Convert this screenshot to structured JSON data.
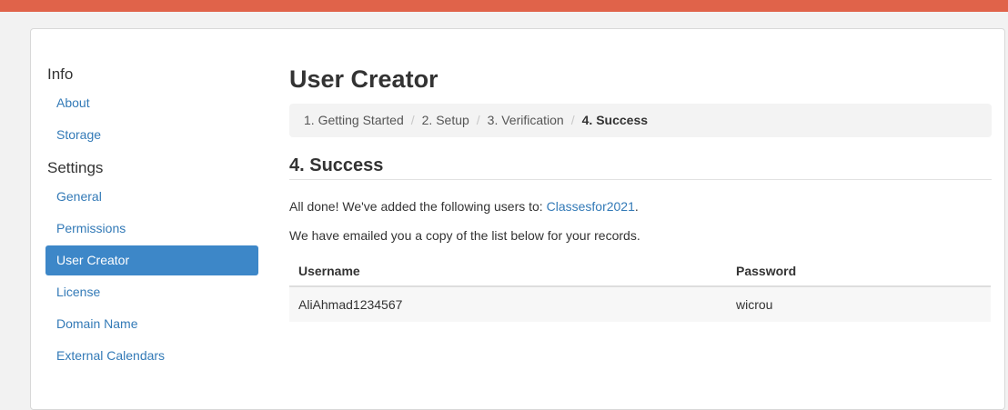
{
  "colors": {
    "topbar": "#e0634a",
    "link": "#337ab7",
    "active_item_bg": "#3d87c8"
  },
  "sidebar": {
    "sections": [
      {
        "heading": "Info",
        "items": [
          "About",
          "Storage"
        ]
      },
      {
        "heading": "Settings",
        "items": [
          "General",
          "Permissions",
          "User Creator",
          "License",
          "Domain Name",
          "External Calendars"
        ]
      }
    ],
    "active_item": "User Creator"
  },
  "main": {
    "title": "User Creator",
    "breadcrumb": {
      "steps": [
        "1. Getting Started",
        "2. Setup",
        "3. Verification",
        "4. Success"
      ],
      "separator": "/",
      "current_index": 3
    },
    "section_title": "4. Success",
    "message_prefix": "All done! We've added the following users to: ",
    "message_link": "Classesfor2021",
    "message_suffix": ".",
    "message2": "We have emailed you a copy of the list below for your records.",
    "table": {
      "headers": {
        "username": "Username",
        "password": "Password"
      },
      "rows": [
        {
          "username": "AliAhmad1234567",
          "password": "wicrou"
        }
      ]
    }
  }
}
